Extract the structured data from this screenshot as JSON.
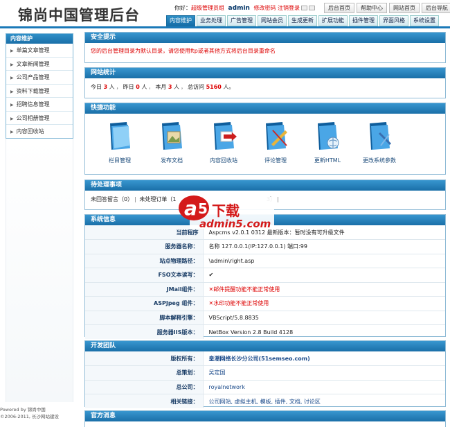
{
  "header": {
    "logo": "锦尚中国管理后台",
    "greeting": "你好：",
    "role": "超级管理员组",
    "username": "admin",
    "change_password": "修改密码",
    "logout": "注销登录",
    "top_links": [
      "后台首页",
      "帮助中心",
      "网站首页",
      "后台导航"
    ]
  },
  "nav": {
    "tabs": [
      "内容维护",
      "业务处理",
      "广告管理",
      "网站会员",
      "生成更新",
      "扩展功能",
      "插件管理",
      "界面风格",
      "系统设置"
    ],
    "active": 0
  },
  "sidebar": {
    "title": "内容维护",
    "items": [
      "单篇文章管理",
      "文章新闻管理",
      "公司产品管理",
      "资料下载管理",
      "招聘信息管理",
      "公司相册管理",
      "内容回收站"
    ]
  },
  "footer": {
    "line1": "Powered by 锦尚中国",
    "line2": "©2006-2011, 长沙网站建设"
  },
  "security": {
    "title": "安全提示",
    "message": "您的后台管理目录为默认目录，请您使用ftp或者其他方式将后台目录重命名"
  },
  "stats": {
    "title": "网站统计",
    "today_label": "今日",
    "today": "3",
    "yesterday_label": "昨日",
    "yesterday": "0",
    "month_label": "本月",
    "month": "3",
    "total_label": "总访问",
    "total": "5160",
    "unit": "人"
  },
  "quick": {
    "title": "快捷功能",
    "items": [
      {
        "label": "栏目管理",
        "icon": "folder-icon"
      },
      {
        "label": "发布文档",
        "icon": "document-image-icon"
      },
      {
        "label": "内容回收站",
        "icon": "recycle-bin-icon"
      },
      {
        "label": "评论管理",
        "icon": "comment-pen-icon"
      },
      {
        "label": "更新HTML",
        "icon": "globe-update-icon"
      },
      {
        "label": "更改系统参数",
        "icon": "system-settings-icon"
      }
    ]
  },
  "pending": {
    "title": "待处理事项",
    "unanswered": "未回答留言（0）",
    "unprocessed": "未处理订单（1",
    "tail": "3）"
  },
  "system": {
    "title": "系统信息",
    "rows": [
      {
        "k": "当前程序",
        "v": "Aspcms v2.0.1 0312 最新版本：暂时没有可升级文件"
      },
      {
        "k": "服务器名称：",
        "v": "名称 127.0.0.1(IP:127.0.0.1) 端口:99"
      },
      {
        "k": "站点物理路径：",
        "v": "\\admin\\right.asp"
      },
      {
        "k": "FSO文本读写：",
        "v": "✔"
      },
      {
        "k": "JMail组件：",
        "v": "✕邮件提醒功能不能正常使用"
      },
      {
        "k": "ASPJpeg 组件：",
        "v": "✕水印功能不能正常使用"
      },
      {
        "k": "脚本解释引擎：",
        "v": "VBScript/5.8.8835"
      },
      {
        "k": "服务器IIS版本：",
        "v": "NetBox Version 2.8 Build 4128"
      }
    ]
  },
  "team": {
    "title": "开发团队",
    "rows": [
      {
        "k": "版权所有：",
        "v": "皇潮网络长沙分公司(51semseo.com)"
      },
      {
        "k": "总策划：",
        "v": "吴定国"
      },
      {
        "k": "总公司：",
        "v": "royalnetwork"
      },
      {
        "k": "相关链接：",
        "v": "公司网站, 虚拟主机, 模板, 插件, 文档, 讨论区"
      }
    ]
  },
  "official": {
    "title": "官方消息"
  },
  "watermark": {
    "brand": "a5下载",
    "site": "admin5.com"
  },
  "colors": {
    "accent": "#1a6fa8",
    "warning": "#dd0000"
  }
}
